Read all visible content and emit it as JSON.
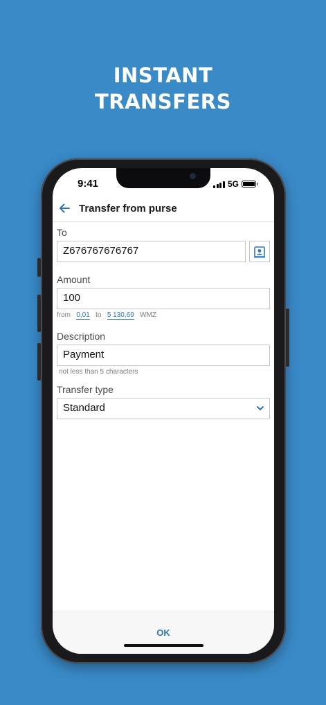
{
  "promo": {
    "line1": "INSTANT",
    "line2": "TRANSFERS"
  },
  "status_bar": {
    "time": "9:41",
    "network": "5G"
  },
  "appbar": {
    "title": "Transfer from purse",
    "back_icon": "arrow-left-icon"
  },
  "form": {
    "to": {
      "label": "To",
      "value": "Z676767676767",
      "contact_icon": "contact-card-icon"
    },
    "amount": {
      "label": "Amount",
      "value": "100",
      "hint_from": "from",
      "min": "0,01",
      "hint_to": "to",
      "max": "5 130,69",
      "currency": "WMZ"
    },
    "description": {
      "label": "Description",
      "value": "Payment",
      "hint": "not less than 5 characters"
    },
    "transfer_type": {
      "label": "Transfer type",
      "value": "Standard",
      "dropdown_icon": "chevron-down-icon"
    }
  },
  "footer": {
    "ok_label": "OK"
  },
  "colors": {
    "background": "#3a8ac8",
    "accent": "#2e74b8"
  }
}
